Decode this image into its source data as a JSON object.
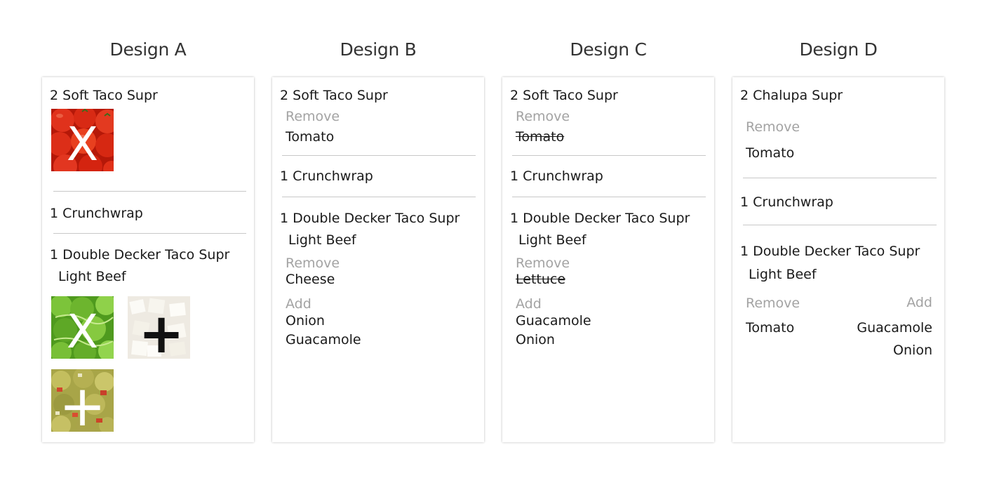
{
  "designs": [
    {
      "title": "Design A",
      "item1": "2 Soft Taco Supr",
      "item2": "1 Crunchwrap",
      "item3": "1 Double Decker Taco Supr",
      "item3_mod": "Light Beef",
      "images": [
        {
          "icon": "tomato-remove-icon",
          "mark": "X"
        },
        {
          "icon": "lettuce-remove-icon",
          "mark": "X"
        },
        {
          "icon": "onion-add-icon",
          "mark": "+"
        },
        {
          "icon": "guacamole-add-icon",
          "mark": "+"
        }
      ]
    },
    {
      "title": "Design B",
      "item1": "2 Soft Taco Supr",
      "item1_remove_label": "Remove",
      "item1_remove": "Tomato",
      "item2": "1 Crunchwrap",
      "item3": "1 Double Decker Taco Supr",
      "item3_mod": "Light Beef",
      "item3_remove_label": "Remove",
      "item3_remove": "Cheese",
      "item3_add_label": "Add",
      "item3_add": [
        "Onion",
        "Guacamole"
      ]
    },
    {
      "title": "Design C",
      "item1": "2 Soft Taco Supr",
      "item1_remove_label": "Remove",
      "item1_remove": "Tomato",
      "item2": "1 Crunchwrap",
      "item3": "1 Double Decker Taco Supr",
      "item3_mod": "Light Beef",
      "item3_remove_label": "Remove",
      "item3_remove": "Lettuce",
      "item3_add_label": "Add",
      "item3_add": [
        "Guacamole",
        "Onion"
      ]
    },
    {
      "title": "Design D",
      "item1": "2 Chalupa Supr",
      "item1_remove_label": "Remove",
      "item1_remove": "Tomato",
      "item2": "1 Crunchwrap",
      "item3": "1 Double Decker Taco Supr",
      "item3_mod": "Light Beef",
      "item3_remove_label": "Remove",
      "item3_add_label": "Add",
      "item3_remove": "Tomato",
      "item3_add": [
        "Guacamole",
        "Onion"
      ]
    }
  ],
  "colors": {
    "muted_label": "#a3a3a3",
    "divider": "#c8c8c8",
    "text": "#1a1a1a"
  }
}
